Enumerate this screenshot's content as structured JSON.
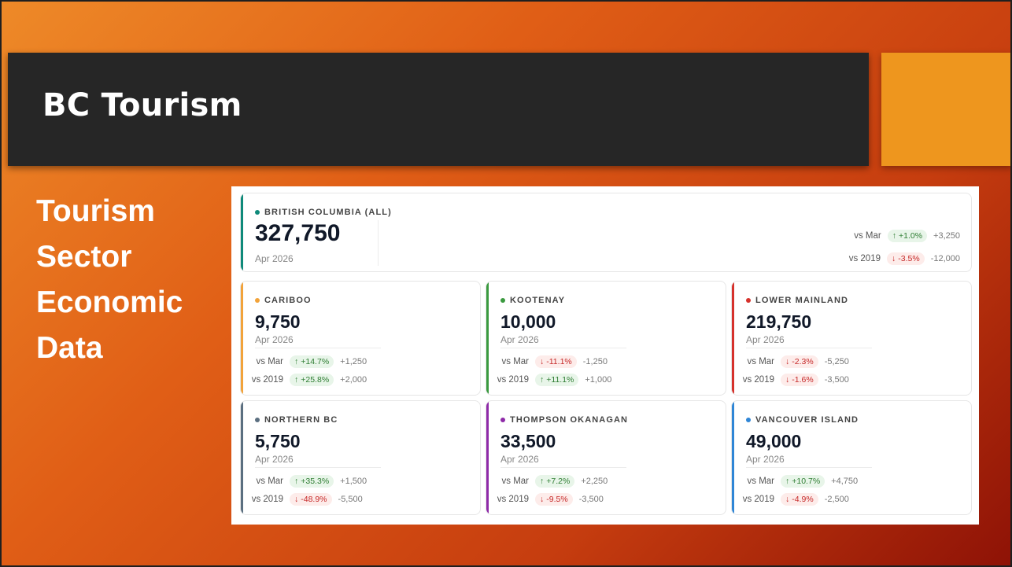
{
  "slide": {
    "title": "BC Tourism",
    "subtitle": [
      "Tourism",
      "Sector",
      "Economic",
      "Data"
    ]
  },
  "summary": {
    "region": "BRITISH COLUMBIA (ALL)",
    "value": "327,750",
    "period": "Apr 2026",
    "accent": "#0f8a7a",
    "vs_mar": {
      "label": "vs Mar",
      "pct": "+1.0%",
      "abs": "+3,250",
      "dir": "up"
    },
    "vs_2019": {
      "label": "vs 2019",
      "pct": "-3.5%",
      "abs": "-12,000",
      "dir": "down"
    }
  },
  "regions": [
    {
      "name": "CARIBOO",
      "value": "9,750",
      "period": "Apr 2026",
      "accent": "#f2a33a",
      "vs_mar": {
        "label": "vs Mar",
        "pct": "+14.7%",
        "abs": "+1,250",
        "dir": "up"
      },
      "vs_2019": {
        "label": "vs 2019",
        "pct": "+25.8%",
        "abs": "+2,000",
        "dir": "up"
      }
    },
    {
      "name": "KOOTENAY",
      "value": "10,000",
      "period": "Apr 2026",
      "accent": "#3a9a3f",
      "vs_mar": {
        "label": "vs Mar",
        "pct": "-11.1%",
        "abs": "-1,250",
        "dir": "down"
      },
      "vs_2019": {
        "label": "vs 2019",
        "pct": "+11.1%",
        "abs": "+1,000",
        "dir": "up"
      }
    },
    {
      "name": "LOWER MAINLAND",
      "value": "219,750",
      "period": "Apr 2026",
      "accent": "#d6322c",
      "vs_mar": {
        "label": "vs Mar",
        "pct": "-2.3%",
        "abs": "-5,250",
        "dir": "down"
      },
      "vs_2019": {
        "label": "vs 2019",
        "pct": "-1.6%",
        "abs": "-3,500",
        "dir": "down"
      }
    },
    {
      "name": "NORTHERN BC",
      "value": "5,750",
      "period": "Apr 2026",
      "accent": "#5b6f80",
      "vs_mar": {
        "label": "vs Mar",
        "pct": "+35.3%",
        "abs": "+1,500",
        "dir": "up"
      },
      "vs_2019": {
        "label": "vs 2019",
        "pct": "-48.9%",
        "abs": "-5,500",
        "dir": "down"
      }
    },
    {
      "name": "THOMPSON OKANAGAN",
      "value": "33,500",
      "period": "Apr 2026",
      "accent": "#8e2aa8",
      "vs_mar": {
        "label": "vs Mar",
        "pct": "+7.2%",
        "abs": "+2,250",
        "dir": "up"
      },
      "vs_2019": {
        "label": "vs 2019",
        "pct": "-9.5%",
        "abs": "-3,500",
        "dir": "down"
      }
    },
    {
      "name": "VANCOUVER ISLAND",
      "value": "49,000",
      "period": "Apr 2026",
      "accent": "#2f86d6",
      "vs_mar": {
        "label": "vs Mar",
        "pct": "+10.7%",
        "abs": "+4,750",
        "dir": "up"
      },
      "vs_2019": {
        "label": "vs 2019",
        "pct": "-4.9%",
        "abs": "-2,500",
        "dir": "down"
      }
    }
  ]
}
